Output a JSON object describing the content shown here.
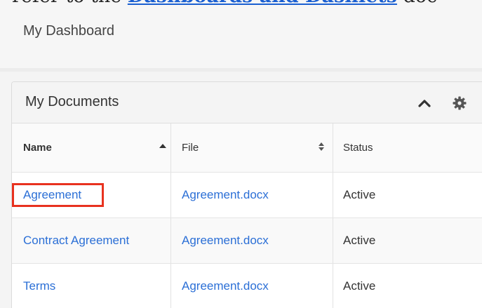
{
  "intro": {
    "prefix": "refer to the",
    "link": "Dashboards and Dashlets",
    "suffix": "doc"
  },
  "dashboard": {
    "title": "My Dashboard"
  },
  "dashlet": {
    "title": "My Documents",
    "collapse_icon": "chevron-up-icon",
    "settings_icon": "gear-icon"
  },
  "table": {
    "columns": [
      {
        "label": "Name",
        "sort": "ascending"
      },
      {
        "label": "File",
        "sort": "sortable"
      },
      {
        "label": "Status",
        "sort": "sortable"
      }
    ],
    "rows": [
      {
        "name": "Agreement",
        "file": "Agreement.docx",
        "status": "Active",
        "highlighted": true
      },
      {
        "name": "Contract Agreement",
        "file": "Agreement.docx",
        "status": "Active",
        "highlighted": false
      },
      {
        "name": "Terms",
        "file": "Agreement.docx",
        "status": "Active",
        "highlighted": false
      }
    ]
  },
  "colors": {
    "link": "#2b6fd6",
    "highlight": "#e8321f",
    "header_bg": "#f4f4f4"
  }
}
